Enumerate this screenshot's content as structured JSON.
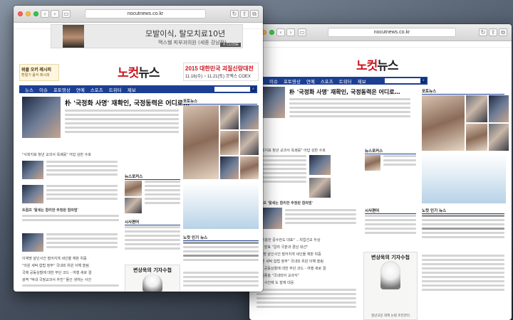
{
  "browser": {
    "url": "nocutnews.co.kr"
  },
  "site": {
    "logo_main": "노컷",
    "logo_sub": "뉴스",
    "nav": [
      "뉴스",
      "이슈",
      "포토영상",
      "연예",
      "스포츠",
      "트위터",
      "제보"
    ],
    "top_ad": {
      "line1": "모발이식, 탈모치료10년",
      "line2": "맥스웰 피부과의원 (세종 강남점)",
      "close": "✕ CLOSE"
    },
    "side_ad": {
      "title": "위클 오키 레시피",
      "text": "환절기 음식 레시피"
    },
    "banner": {
      "year": "2015 대한민국 괴질신랑대전",
      "date": "11.16(수) ~ 11.21(토) 코엑스 COEX"
    },
    "headline": "朴 '국정화 사명' 재확인, 국정동력은 어디로…",
    "sub_headline": "\"사회지표 청년 교과서 옥쇄를\" 어답 상반 수호",
    "section_photo": "포토뉴스",
    "section_news": "뉴스포커스",
    "section_opinion": "시사편어",
    "section_hot": "노컷 인기 뉴스",
    "cartoon_title": "변상욱의 기자수첩",
    "cartoon_caption": "청년고민 대책 논평 조언한다",
    "featured": "트럼프 '탈세는 합리한 추정된 합의범'",
    "list_items": [
      "\"조기흥한 중수한도 대표\" …직업선교 두상",
      "한국 발표 \"갈라 국분과 경남 대선\"",
      "이재명 살인사건 벌어지게 세인물 재판 위증",
      "\"의원 세탁 합법 정부\" 국내외 위원 이해 쏠림",
      "국제 공동상황에 대한 무단 코드 - 여행 새로 결",
      "김 임종술 \"국내되어 교과식\"",
      "아동 사건에 도 발제 대응"
    ],
    "ad_ribbon": "광역 \"박내 국정교과서 추진\" 들인 생하는 사건"
  }
}
